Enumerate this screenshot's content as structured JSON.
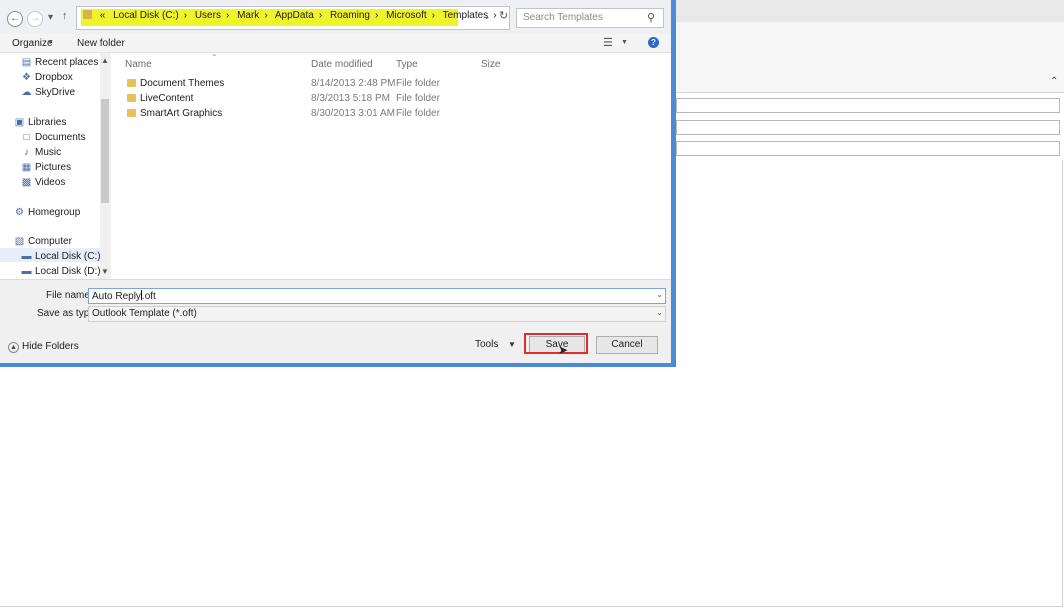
{
  "address_bar": {
    "path": [
      "Local Disk (C:)",
      "Users",
      "Mark",
      "AppData",
      "Roaming",
      "Microsoft",
      "Templates"
    ],
    "highlight_color": "#eef32a"
  },
  "search": {
    "placeholder": "Search Templates"
  },
  "toolbar": {
    "organize": "Organize",
    "new_folder": "New folder"
  },
  "nav_pane": {
    "items": [
      {
        "label": "Recent places",
        "icon": "recent-places-icon"
      },
      {
        "label": "Dropbox",
        "icon": "dropbox-icon"
      },
      {
        "label": "SkyDrive",
        "icon": "skydrive-icon"
      },
      {
        "label": "Libraries",
        "icon": "libraries-icon"
      },
      {
        "label": "Documents",
        "icon": "documents-icon"
      },
      {
        "label": "Music",
        "icon": "music-icon"
      },
      {
        "label": "Pictures",
        "icon": "pictures-icon"
      },
      {
        "label": "Videos",
        "icon": "videos-icon"
      },
      {
        "label": "Homegroup",
        "icon": "homegroup-icon"
      },
      {
        "label": "Computer",
        "icon": "computer-icon"
      },
      {
        "label": "Local Disk (C:)",
        "icon": "drive-icon"
      },
      {
        "label": "Local Disk (D:)",
        "icon": "drive-icon"
      }
    ]
  },
  "file_list": {
    "columns": [
      "Name",
      "Date modified",
      "Type",
      "Size"
    ],
    "rows": [
      {
        "name": "Document Themes",
        "date": "8/14/2013 2:48 PM",
        "type": "File folder"
      },
      {
        "name": "LiveContent",
        "date": "8/3/2013 5:18 PM",
        "type": "File folder"
      },
      {
        "name": "SmartArt Graphics",
        "date": "8/30/2013 3:01 AM",
        "type": "File folder"
      }
    ]
  },
  "form": {
    "file_name_label": "File name:",
    "file_name_before_caret": "Auto Reply",
    "file_name_after_caret": ".oft",
    "save_as_type_label": "Save as type:",
    "save_as_type_value": "Outlook Template (*.oft)"
  },
  "footer": {
    "hide_folders": "Hide Folders",
    "tools": "Tools",
    "save": "Save",
    "cancel": "Cancel",
    "save_highlight_color": "#e02c2c"
  }
}
